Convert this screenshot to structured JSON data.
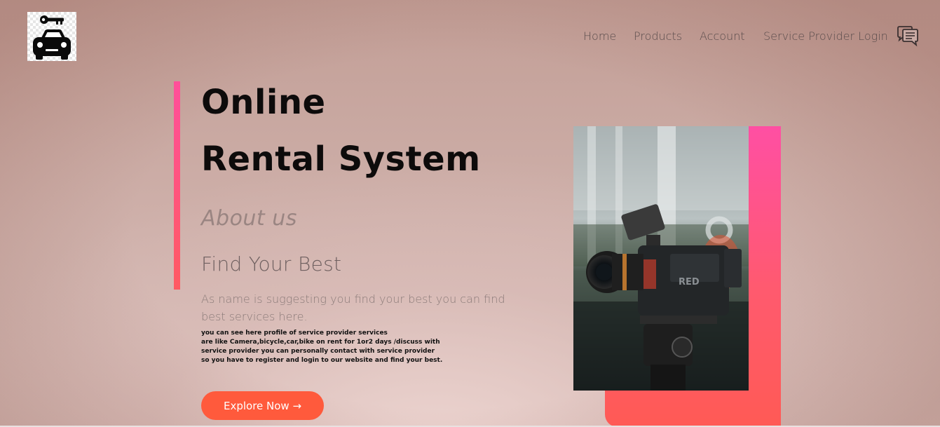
{
  "nav": {
    "items": [
      "Home",
      "Products",
      "Account",
      "Service Provider Login"
    ],
    "chat_icon": "chat-bubbles-icon"
  },
  "logo": {
    "icon": "car-key-icon"
  },
  "hero": {
    "title_line1": "Online",
    "title_line2": "Rental System",
    "about": "About us",
    "subtitle": "Find Your Best",
    "description": "As name is suggesting you find your best you can find best services here.",
    "details": [
      "you can see here profile of service provider services",
      "are like Camera,bicycle,car,bike on rent for 1or2 days /discuss with",
      "service provider you can personally contact with service provider",
      "so you have to register and login to our website and find your best."
    ],
    "cta": "Explore Now →"
  },
  "image": {
    "subject": "cinema-camera-photo"
  },
  "colors": {
    "accent_pink": "#ff4f9a",
    "accent_orange": "#ff5a3c"
  }
}
